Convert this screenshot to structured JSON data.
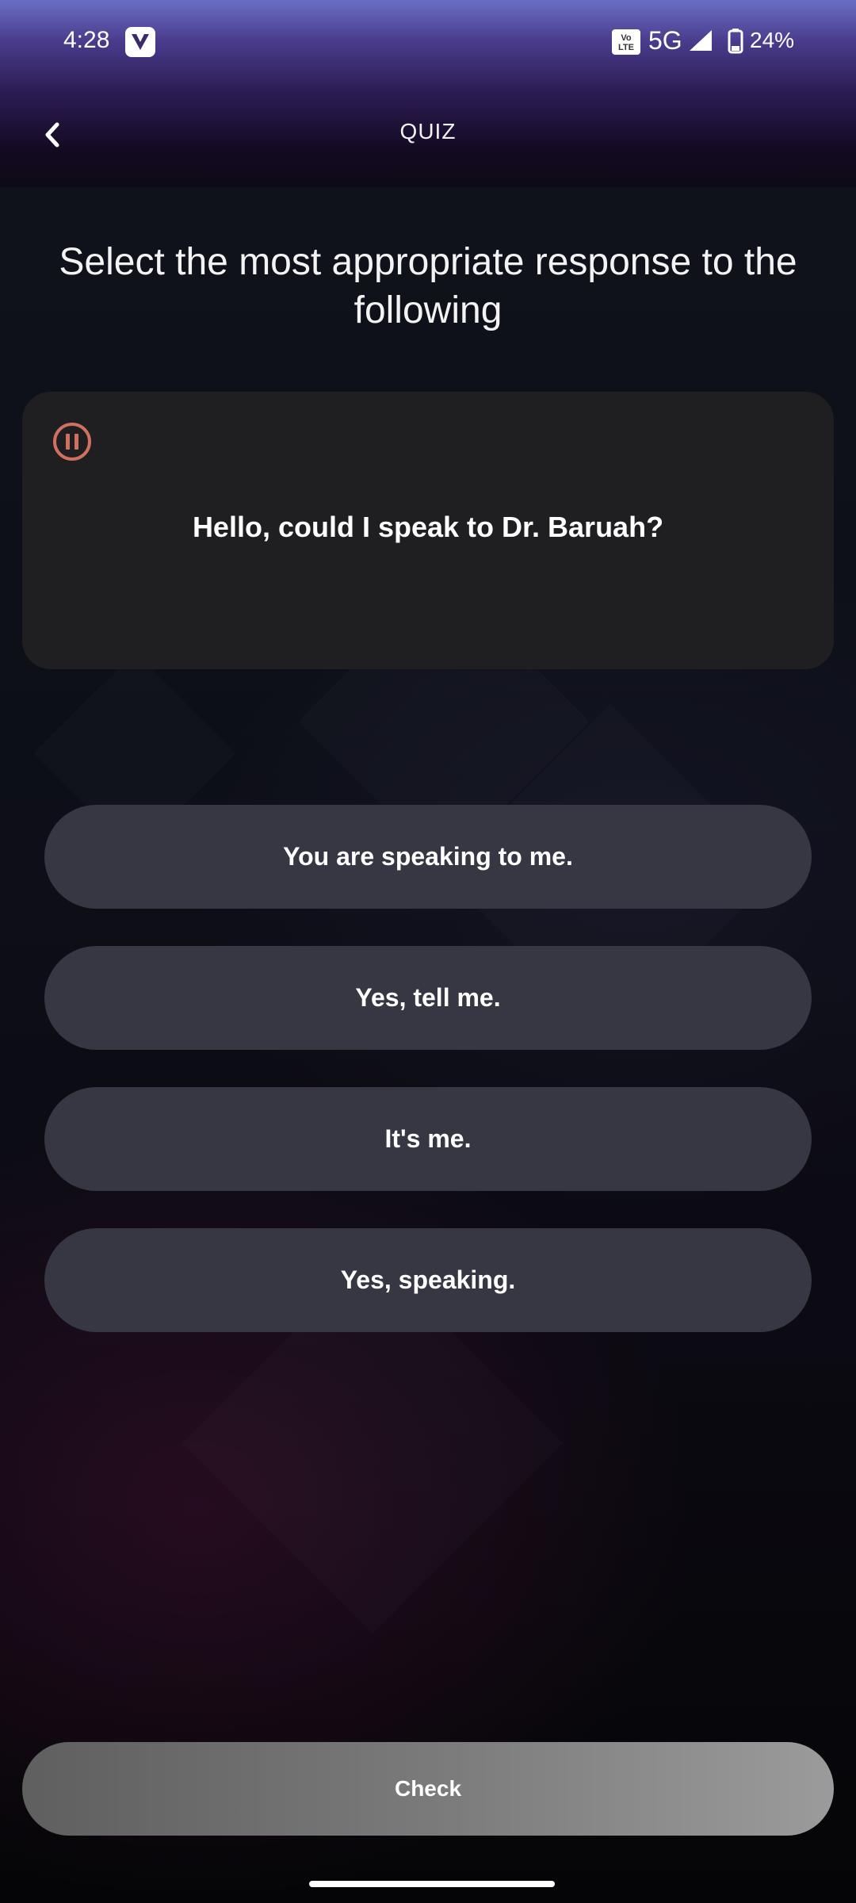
{
  "status_bar": {
    "time": "4:28",
    "volte": "Vo LTE",
    "network": "5G",
    "battery": "24%"
  },
  "header": {
    "title": "QUIZ"
  },
  "quiz": {
    "instruction": "Select the most appropriate response to the following",
    "prompt": "Hello, could I speak to Dr. Baruah?",
    "options": [
      "You are speaking to me.",
      "Yes, tell me.",
      "It's me.",
      "Yes, speaking."
    ],
    "check_label": "Check"
  },
  "colors": {
    "accent_pause": "#d0705e",
    "option_bg": "#363743",
    "card_bg": "#1f1f21"
  }
}
